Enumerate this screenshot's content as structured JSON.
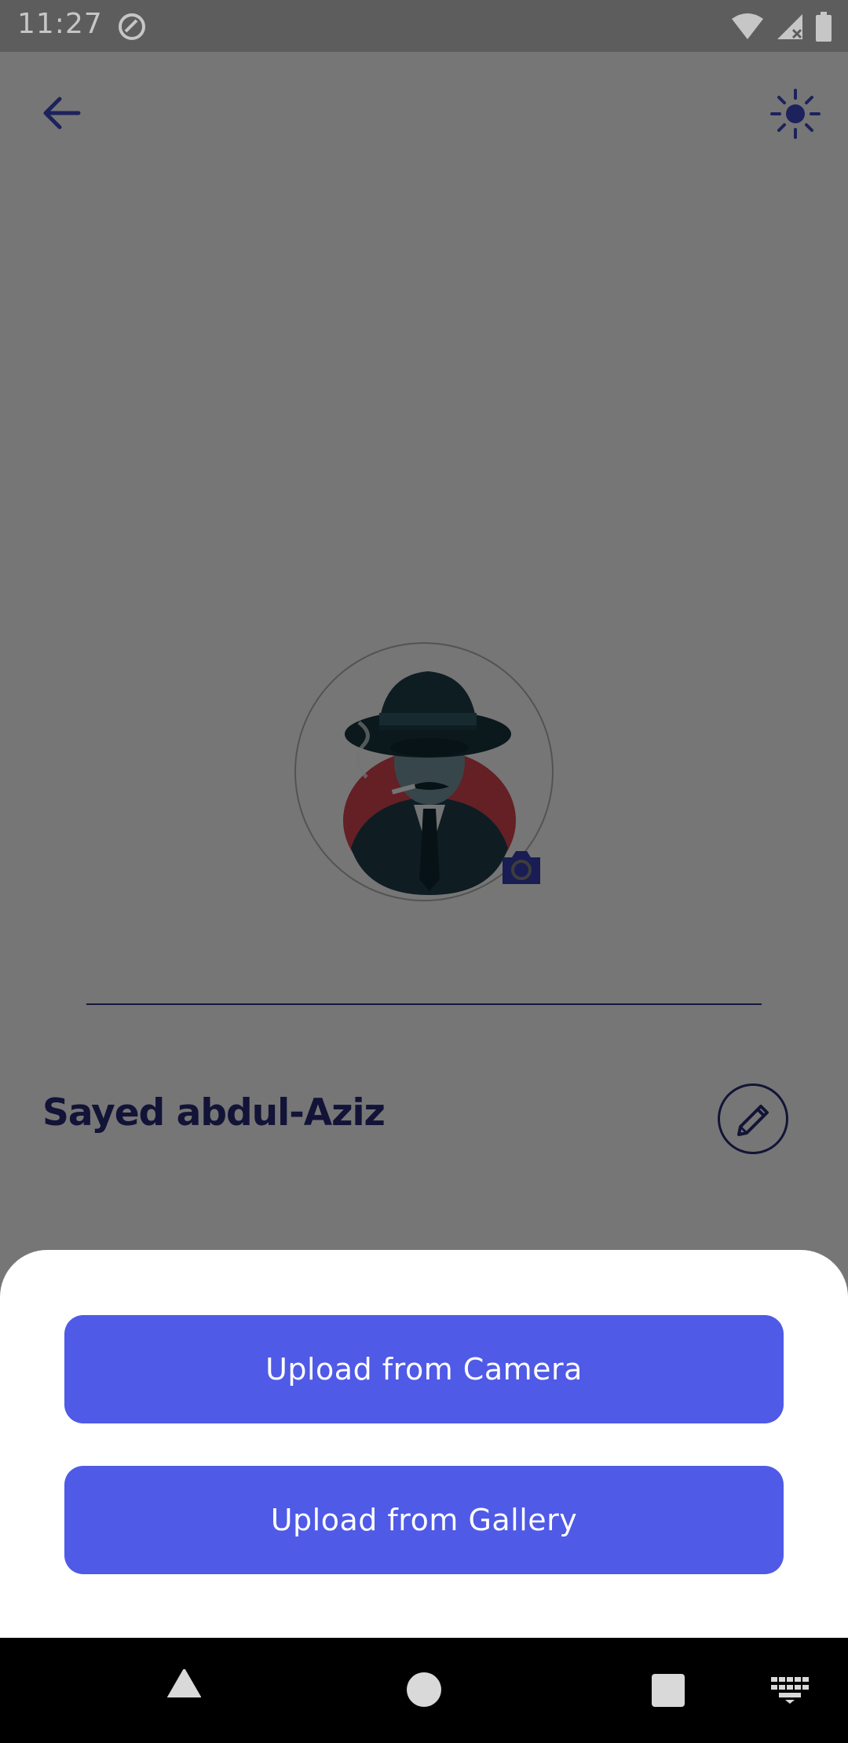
{
  "status_bar": {
    "time": "11:27",
    "left_icon": "data-saver-icon",
    "right_icons": [
      "wifi-icon",
      "signal-no-service-icon",
      "battery-icon"
    ]
  },
  "header": {
    "back_icon": "arrow-back-icon",
    "theme_icon": "brightness-icon"
  },
  "profile": {
    "avatar_icon": "detective-avatar-icon",
    "camera_badge_icon": "camera-icon",
    "name": "Sayed abdul-Aziz",
    "edit_icon": "pencil-icon"
  },
  "bottom_sheet": {
    "camera_label": "Upload from Camera",
    "gallery_label": "Upload from Gallery"
  },
  "nav_bar": {
    "icons": [
      "nav-back-icon",
      "nav-home-icon",
      "nav-recents-icon",
      "keyboard-icon"
    ]
  },
  "colors": {
    "primary": "#4f5ae6",
    "accent_dark": "#24276f",
    "scrim": "#000000",
    "avatar_red": "#c9414b"
  }
}
